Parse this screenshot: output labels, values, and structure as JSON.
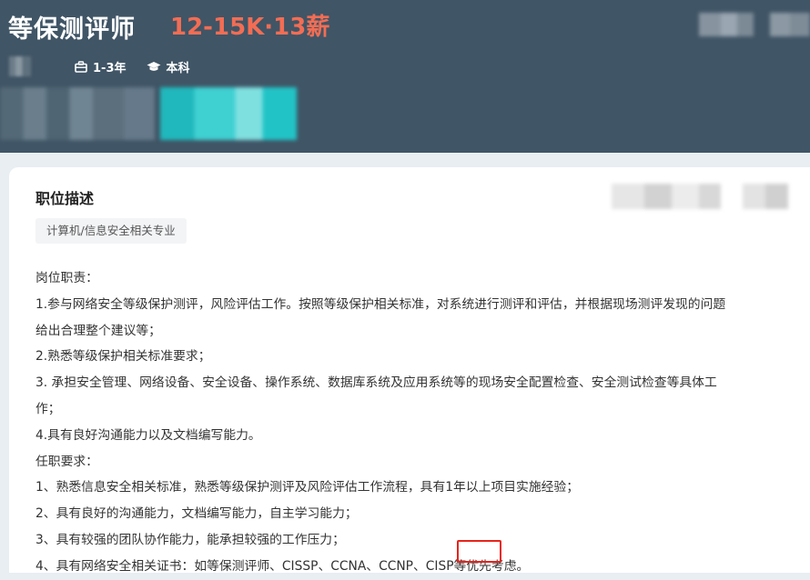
{
  "header": {
    "job_title": "等保测评师",
    "salary": "12-15K·13薪",
    "meta": {
      "experience": "1-3年",
      "education": "本科"
    }
  },
  "description": {
    "section_title": "职位描述",
    "tag": "计算机/信息安全相关专业",
    "lines": [
      "岗位职责：",
      "1.参与网络安全等级保护测评，风险评估工作。按照等级保护相关标准，对系统进行测评和评估，并根据现场测评发现的问题",
      "给出合理整个建议等；",
      "2.熟悉等级保护相关标准要求；",
      "3. 承担安全管理、网络设备、安全设备、操作系统、数据库系统及应用系统等的现场安全配置检查、安全测试检查等具体工",
      "作；",
      "4.具有良好沟通能力以及文档编写能力。",
      "任职要求：",
      "1、熟悉信息安全相关标准，熟悉等级保护测评及风险评估工作流程，具有1年以上项目实施经验；",
      "2、具有良好的沟通能力，文档编写能力，自主学习能力；",
      "3、具有较强的团队协作能力，能承担较强的工作压力；",
      "4、具有网络安全相关证书：如等保测评师、CISSP、CCNA、CCNP、CISP等优先考虑。"
    ]
  },
  "icons": {
    "experience": "briefcase-icon",
    "education": "graduation-cap-icon"
  },
  "colors": {
    "header_bg": "#405566",
    "salary": "#f26d54",
    "highlight_box": "#e8231b"
  }
}
